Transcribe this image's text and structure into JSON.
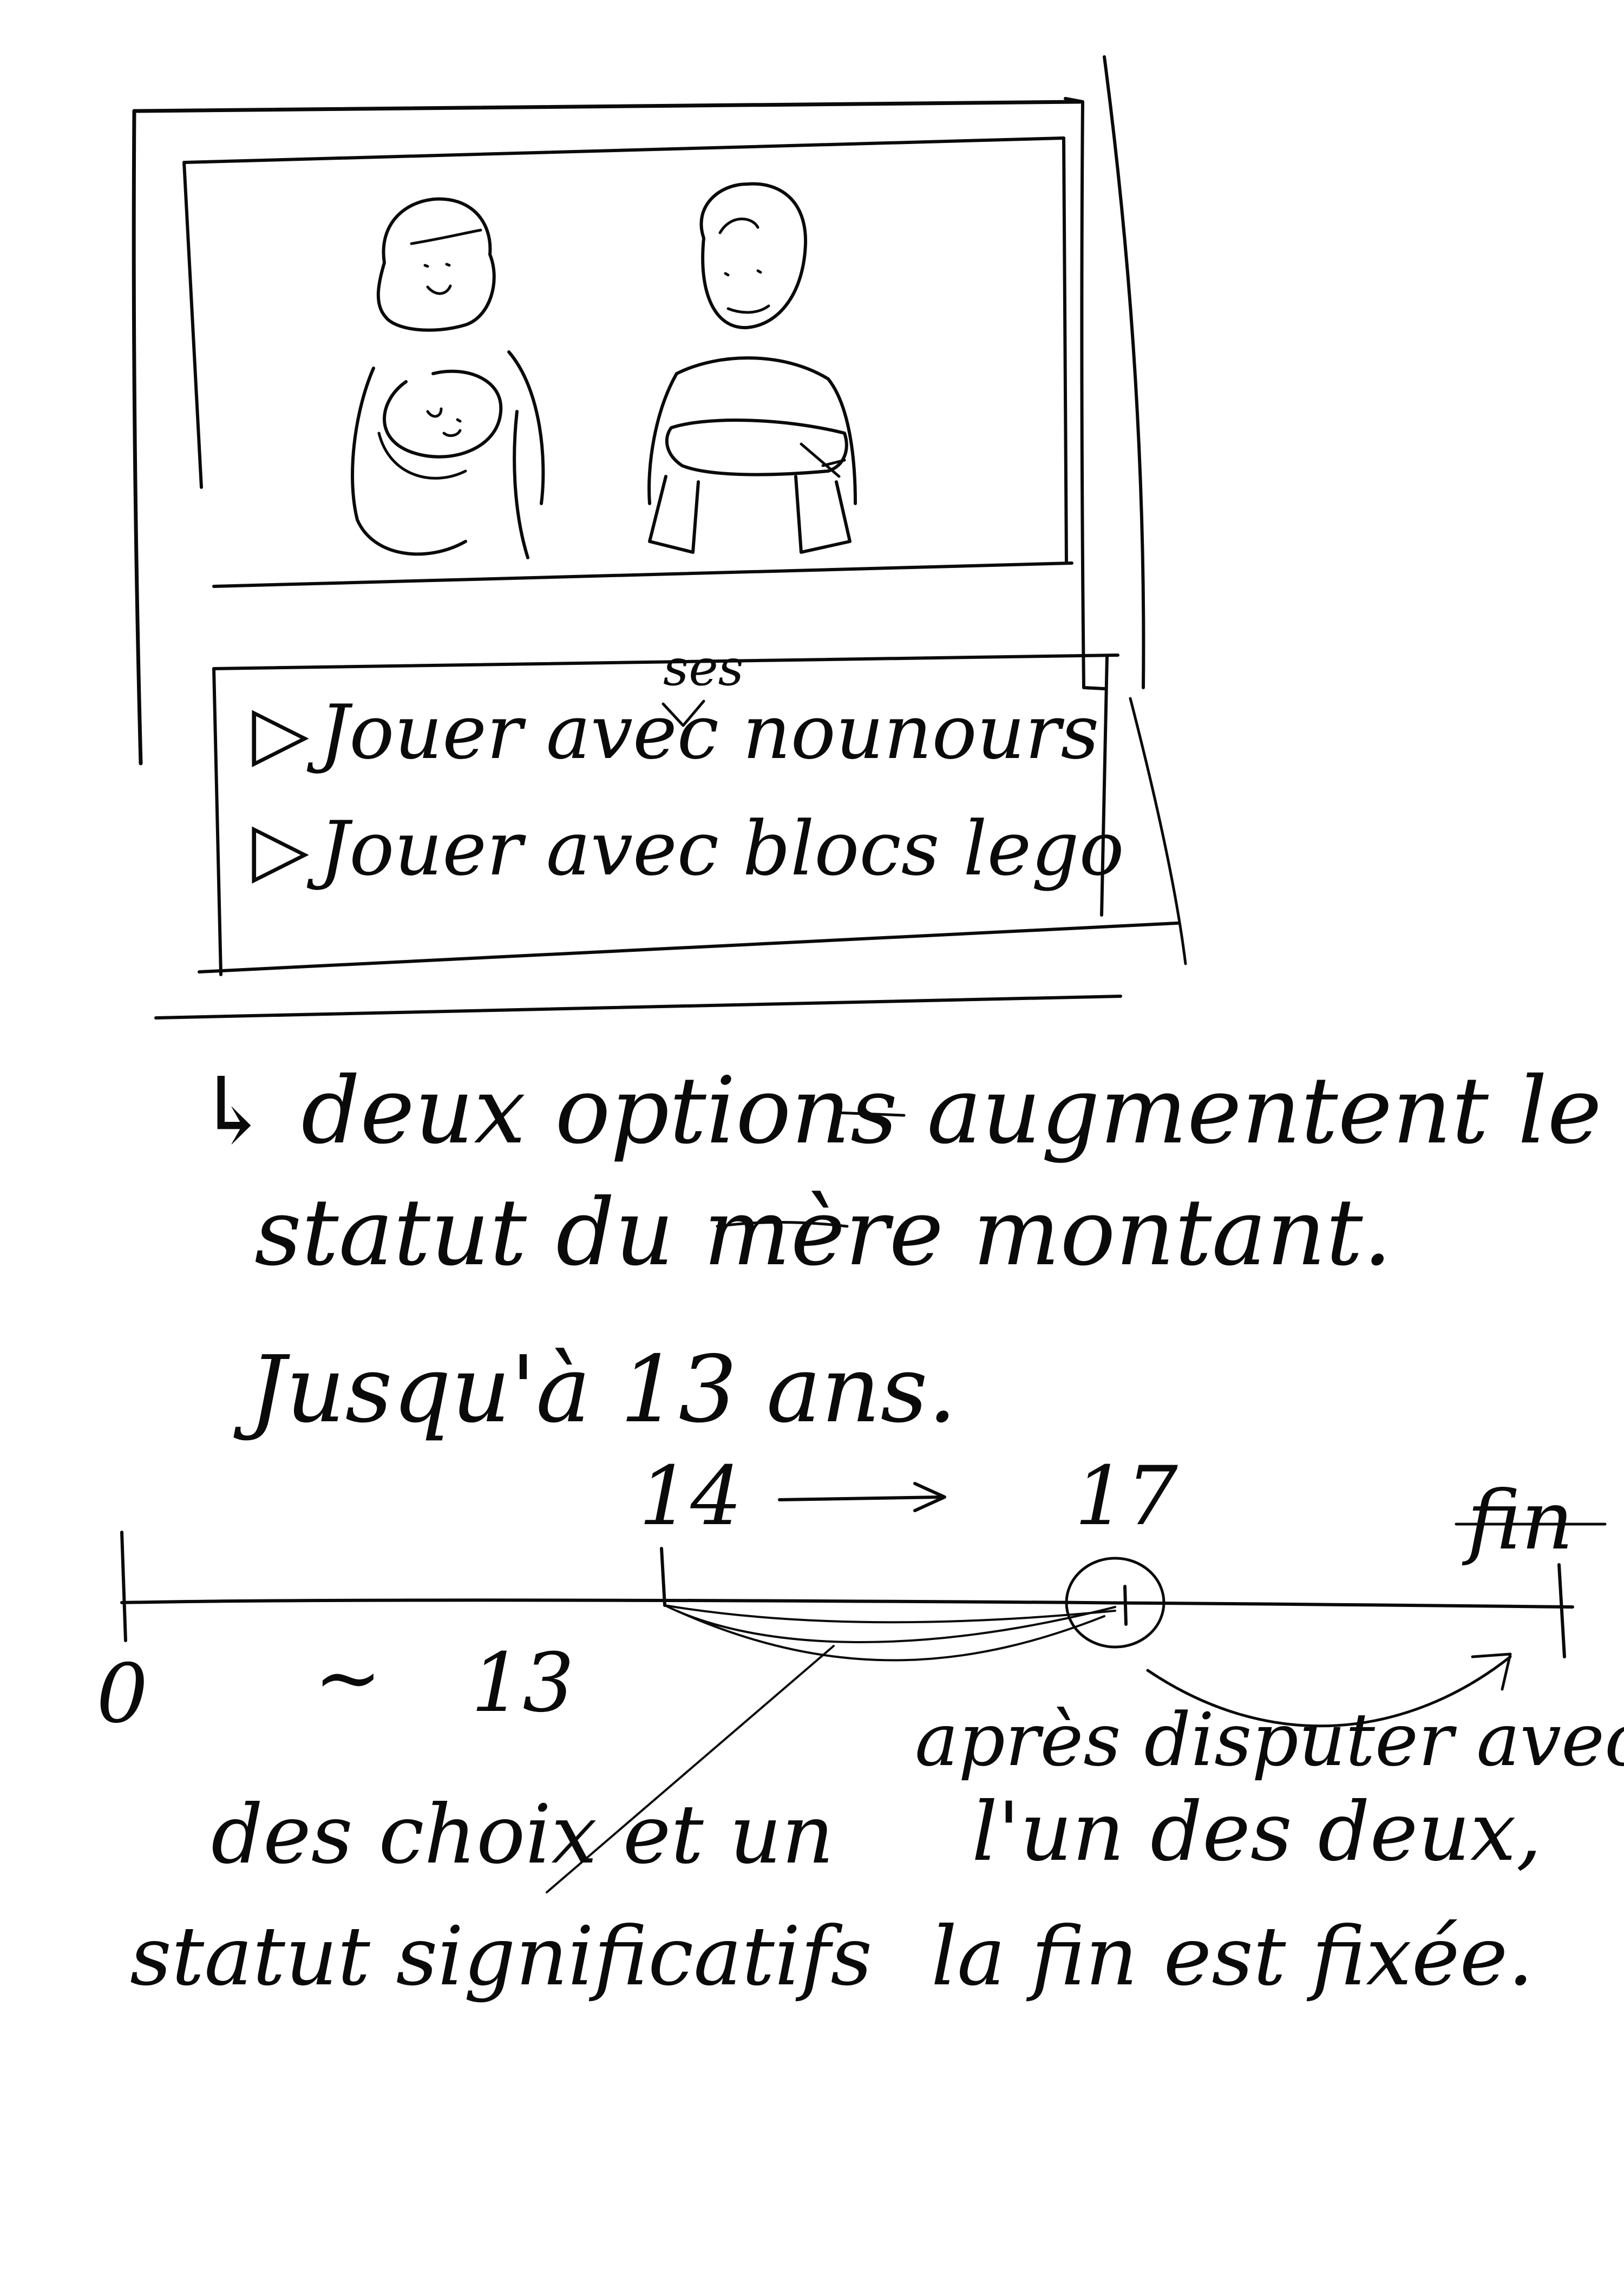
{
  "storyboard": {
    "options": [
      {
        "marker": "▷",
        "text": "Jouer avec nounours",
        "insertion": "ses"
      },
      {
        "marker": "▷",
        "text": "Jouer avec blocs lego"
      }
    ]
  },
  "notes": {
    "line1": "↳ deux options augmentent le",
    "line2": "statut du mère montant.",
    "line3": "Jusqu'à 13 ans."
  },
  "timeline": {
    "start": "0",
    "tilde": "~",
    "age13": "13",
    "age14": "14",
    "age17": "17",
    "end": "fin",
    "left_note": [
      "des choix et un",
      "statut significatifs"
    ],
    "right_note": [
      "après disputer avec",
      "l'un des deux,",
      "la fin est fixée."
    ]
  }
}
